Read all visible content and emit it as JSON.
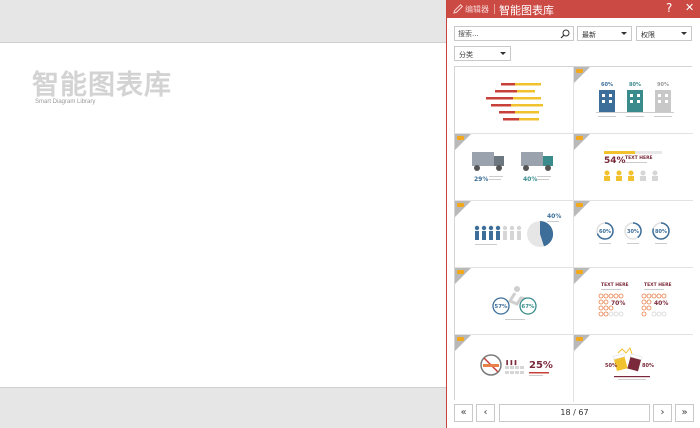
{
  "slide": {
    "title": "智能图表库",
    "subtitle": "Smart Diagram Library"
  },
  "panel": {
    "editor_label": "编辑器",
    "title": "智能图表库",
    "help": "?",
    "close": "✕",
    "search_placeholder": "搜索...",
    "sort_value": "最新",
    "permission_value": "权限",
    "category_value": "分类",
    "page_indicator": "18 / 67",
    "nav": {
      "first": "«",
      "prev": "‹",
      "next": "›",
      "last": "»"
    }
  },
  "thumbs": {
    "t2": [
      "60%",
      "80%",
      "90%"
    ],
    "t4": {
      "pct": "54%",
      "text": "TEXT HERE"
    },
    "t3": [
      "29%",
      "40%"
    ],
    "t5": "40%",
    "t6": [
      "60%",
      "30%",
      "80%"
    ],
    "t7": [
      "57%",
      "67%"
    ],
    "t8": {
      "left_title": "TEXT HERE",
      "right_title": "TEXT HERE",
      "left_pct": "70%",
      "right_pct": "40%"
    },
    "t9": "25%",
    "t10": [
      "50%",
      "80%"
    ]
  },
  "colors": {
    "header": "#cc4a44",
    "blue": "#3d6e99",
    "teal": "#3a8c8c",
    "red": "#c8403a",
    "yellow": "#f2c12e",
    "maroon": "#7a2a3a",
    "orange": "#e8804a"
  }
}
